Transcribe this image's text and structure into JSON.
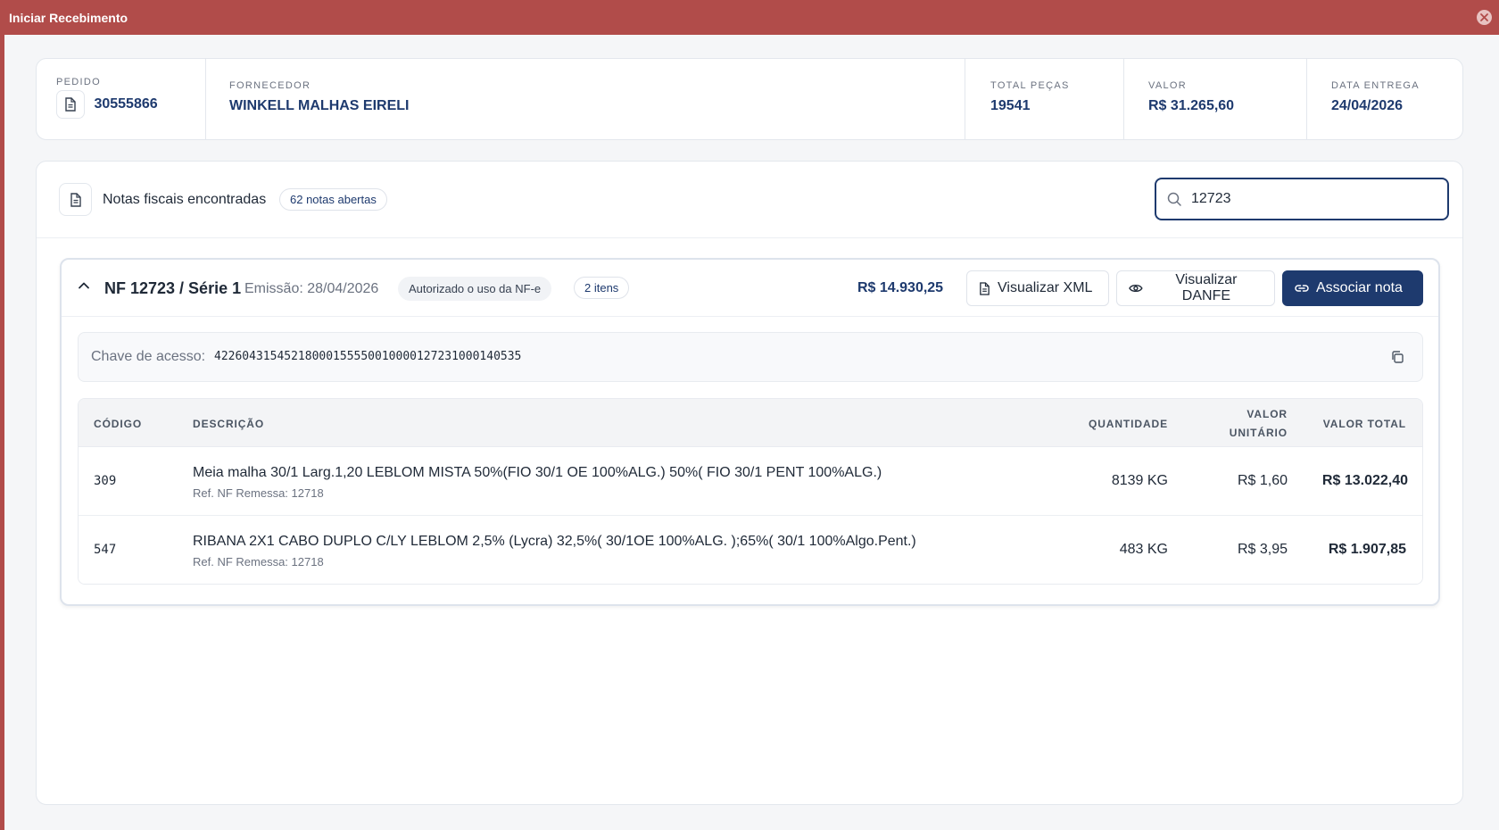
{
  "window": {
    "title": "Iniciar Recebimento"
  },
  "summary": {
    "pedido": {
      "label": "PEDIDO",
      "value": "30555866"
    },
    "fornecedor": {
      "label": "FORNECEDOR",
      "value": "WINKELL MALHAS EIRELI"
    },
    "total_pecas": {
      "label": "TOTAL PEÇAS",
      "value": "19541"
    },
    "valor": {
      "label": "VALOR",
      "value": "R$ 31.265,60"
    },
    "data_entrega": {
      "label": "DATA ENTREGA",
      "value": "24/04/2026"
    }
  },
  "notas": {
    "title": "Notas fiscais encontradas",
    "badge": "62 notas abertas",
    "search_value": "12723"
  },
  "nf": {
    "number": "NF 12723 / Série 1",
    "emissao": "Emissão: 28/04/2026",
    "status": "Autorizado o uso da NF-e",
    "itens": "2 itens",
    "total": "R$ 14.930,25",
    "btn_xml": "Visualizar XML",
    "btn_danfe": "Visualizar DANFE",
    "btn_associar": "Associar nota",
    "chave_label": "Chave de acesso:",
    "chave": "42260431545218000155550010000127231000140535",
    "columns": {
      "codigo": "CÓDIGO",
      "descricao": "DESCRIÇÃO",
      "quantidade": "QUANTIDADE",
      "valor_unitario_1": "VALOR",
      "valor_unitario_2": "UNITÁRIO",
      "valor_total": "VALOR TOTAL"
    },
    "rows": [
      {
        "codigo": "309",
        "descricao": "Meia malha 30/1 Larg.1,20 LEBLOM MISTA 50%(FIO 30/1 OE 100%ALG.) 50%( FIO 30/1 PENT 100%ALG.)",
        "ref": "Ref. NF Remessa: 12718",
        "quantidade": "8139 KG",
        "valor_unitario": "R$ 1,60",
        "valor_total": "R$ 13.022,40"
      },
      {
        "codigo": "547",
        "descricao": "RIBANA 2X1 CABO DUPLO C/LY LEBLOM 2,5% (Lycra) 32,5%( 30/1OE 100%ALG. );65%( 30/1 100%Algo.Pent.)",
        "ref": "Ref. NF Remessa: 12718",
        "quantidade": "483 KG",
        "valor_unitario": "R$ 3,95",
        "valor_total": "R$ 1.907,85"
      }
    ]
  }
}
